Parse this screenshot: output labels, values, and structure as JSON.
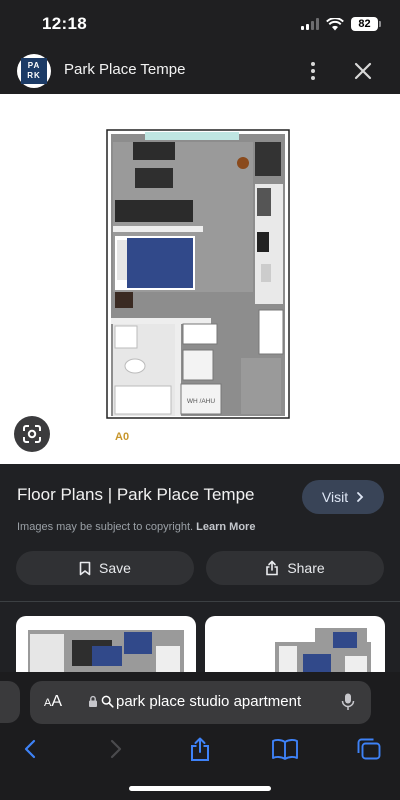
{
  "status_bar": {
    "time": "12:18",
    "battery": "82"
  },
  "header": {
    "logo_line1": "PA",
    "logo_line2": "RK",
    "site_title": "Park Place Tempe"
  },
  "image": {
    "plan_label": "A0",
    "room_label": "WH /AHU"
  },
  "result": {
    "title": "Floor Plans | Park Place Tempe",
    "visit_label": "Visit",
    "copyright_text": "Images may be subject to copyright.",
    "learn_more": "Learn More",
    "save_label": "Save",
    "share_label": "Share"
  },
  "address_bar": {
    "aa_small": "A",
    "aa_large": "A",
    "url": "park place studio apartment"
  },
  "icons": [
    "wifi-icon",
    "cellular-signal-icon",
    "more-vert-icon",
    "close-icon",
    "google-lens-icon",
    "chevron-right-icon",
    "bookmark-icon",
    "share-icon",
    "lock-icon",
    "search-icon",
    "microphone-icon",
    "back-icon",
    "forward-icon",
    "bookmarks-icon",
    "tabs-icon"
  ],
  "colors": {
    "accent_blue": "#3e82f7",
    "panel_bg": "#202124",
    "plan_label": "#c7962c"
  }
}
